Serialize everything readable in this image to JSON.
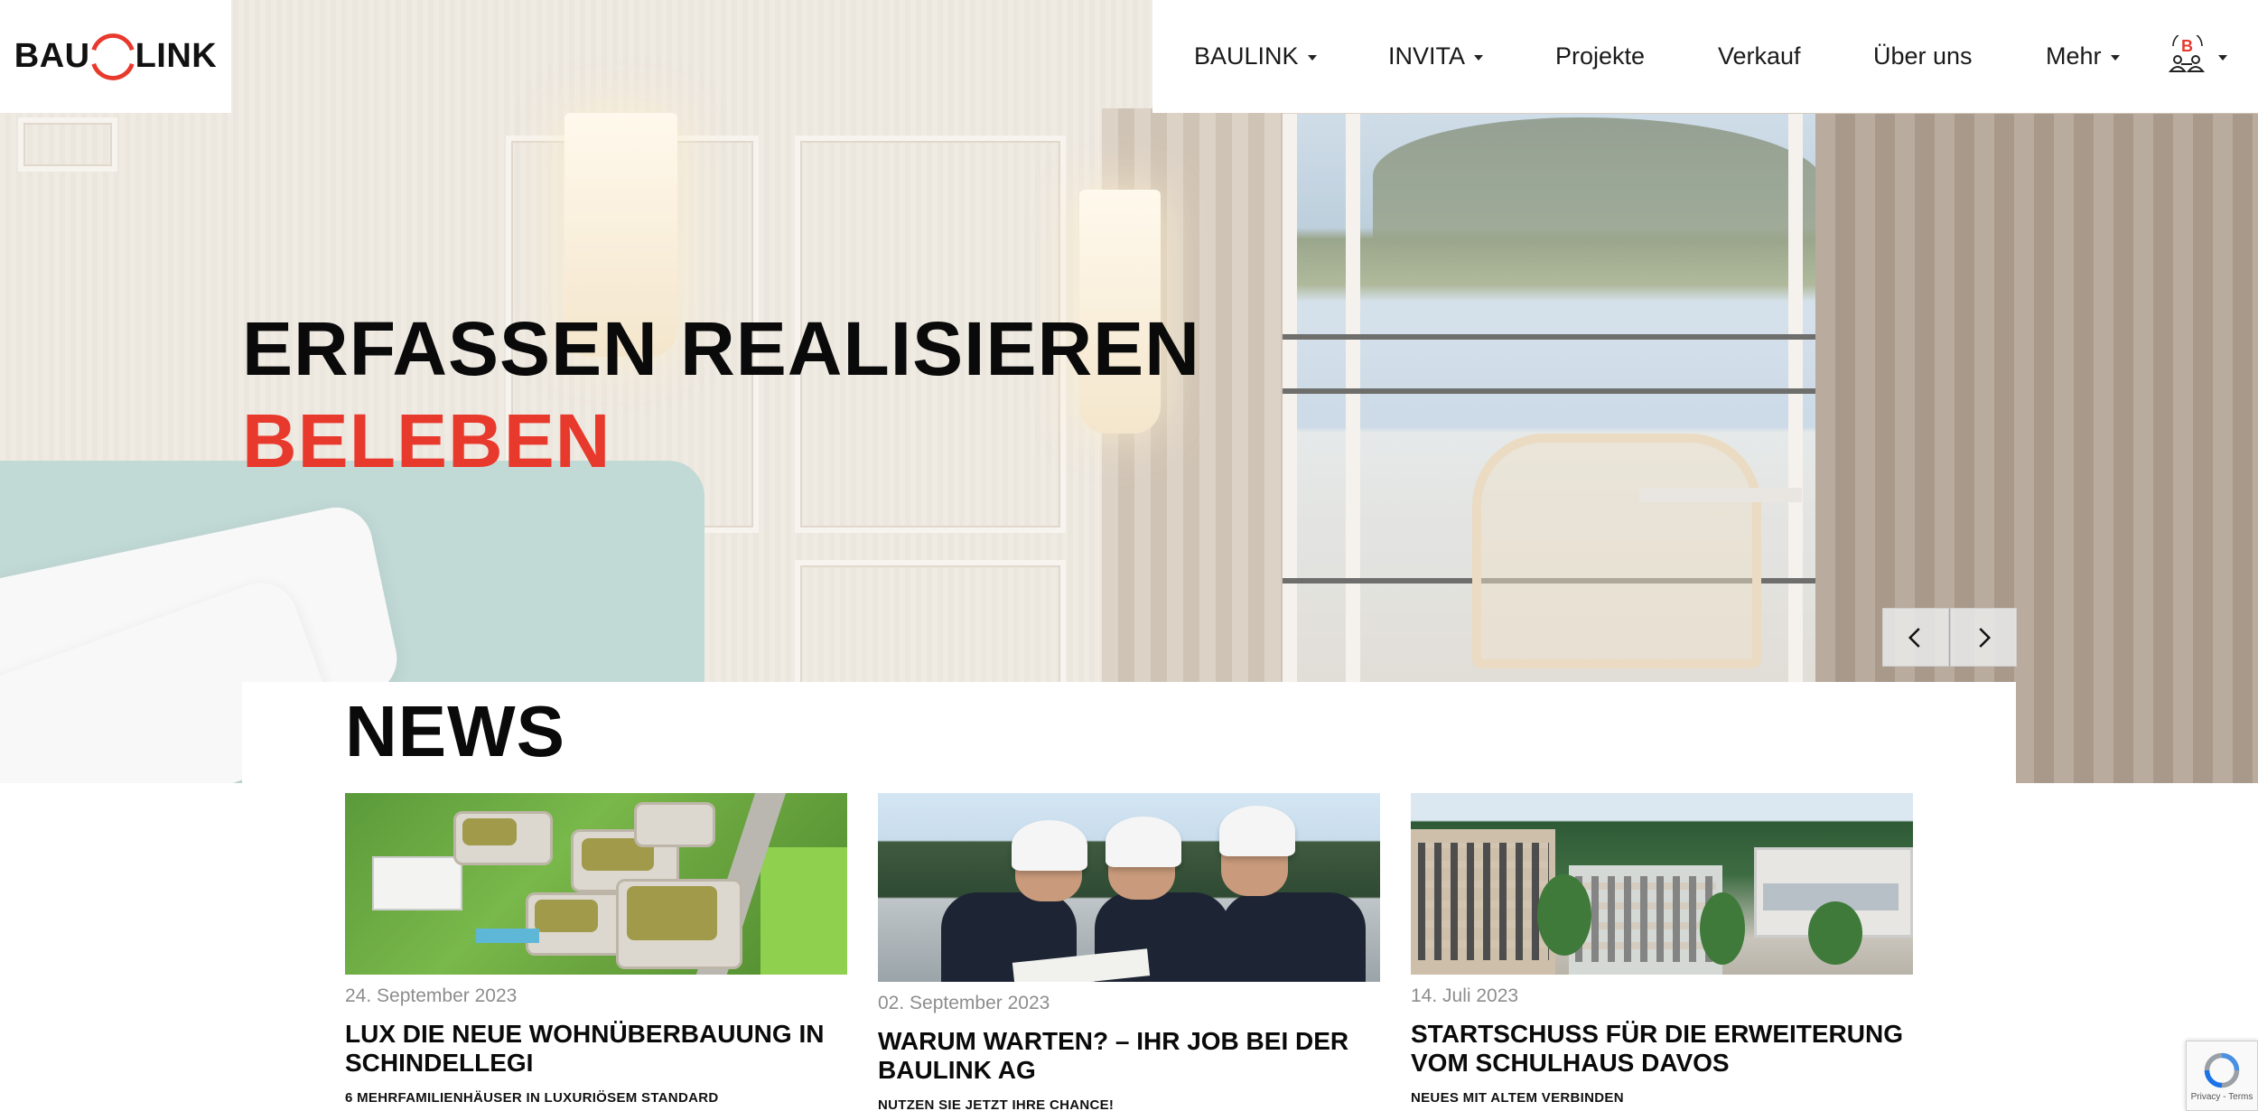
{
  "brand": {
    "logo_left": "BAU",
    "logo_right": "LINK",
    "accent": "#e8392d"
  },
  "nav": {
    "items": [
      {
        "label": "BAULINK",
        "dropdown": true
      },
      {
        "label": "INVITA",
        "dropdown": true
      },
      {
        "label": "Projekte",
        "dropdown": false
      },
      {
        "label": "Verkauf",
        "dropdown": false
      },
      {
        "label": "Über uns",
        "dropdown": false
      },
      {
        "label": "Mehr",
        "dropdown": true
      }
    ],
    "user_icon": "user-group-icon"
  },
  "hero": {
    "line1": "ERFASSEN REALISIEREN",
    "line2": "BELEBEN",
    "prev_icon": "chevron-left-icon",
    "next_icon": "chevron-right-icon"
  },
  "news": {
    "title": "NEWS",
    "cards": [
      {
        "date": "24. September 2023",
        "title": "LUX DIE NEUE WOHNÜBERBAUUNG IN SCHINDELLEGI",
        "subtitle": "6 MEHRFAMILIENHÄUSER IN LUXURIÖSEM STANDARD"
      },
      {
        "date": "02. September 2023",
        "title": "WARUM WARTEN? – IHR JOB BEI DER BAULINK AG",
        "subtitle": "NUTZEN SIE JETZT IHRE CHANCE!"
      },
      {
        "date": "14. Juli 2023",
        "title": "STARTSCHUSS FÜR DIE ERWEITERUNG VOM SCHULHAUS DAVOS",
        "subtitle": "NEUES MIT ALTEM VERBINDEN"
      }
    ]
  },
  "recaptcha": {
    "text": "Privacy - Terms"
  }
}
